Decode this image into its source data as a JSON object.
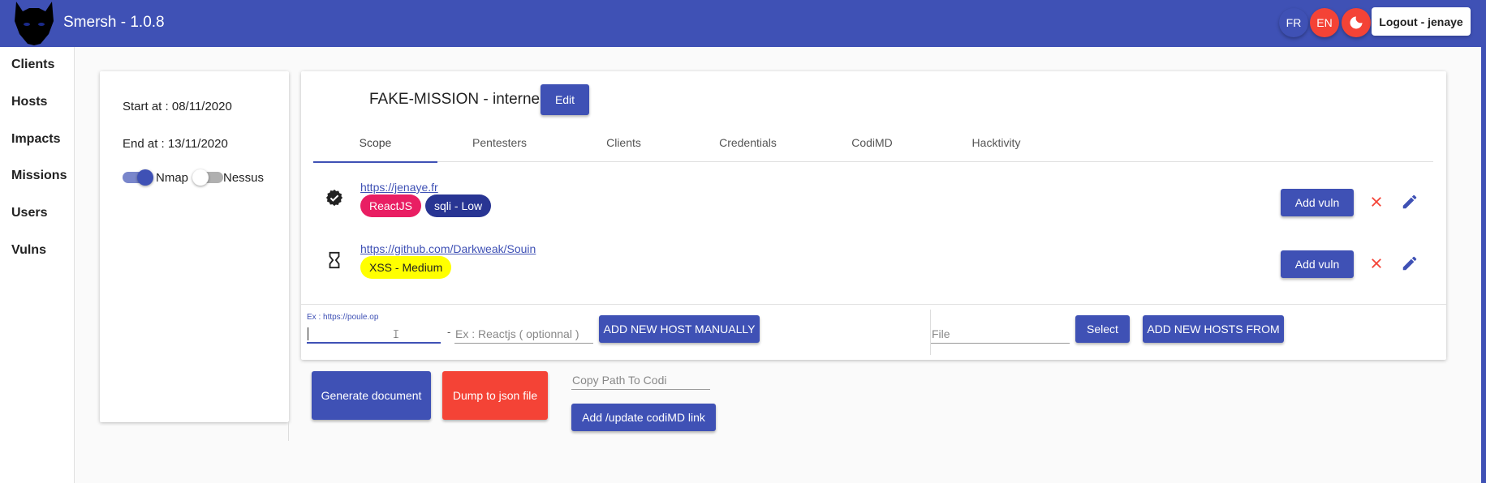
{
  "app": {
    "title": "Smersh - 1.0.8"
  },
  "header": {
    "lang_fr": "FR",
    "lang_en": "EN",
    "logout_label": "Logout - jenaye"
  },
  "sidebar": {
    "items": [
      {
        "label": "Clients"
      },
      {
        "label": "Hosts"
      },
      {
        "label": "Impacts"
      },
      {
        "label": "Missions"
      },
      {
        "label": "Users"
      },
      {
        "label": "Vulns"
      }
    ]
  },
  "mission": {
    "start": "Start at : 08/11/2020",
    "end": "End at : 13/11/2020",
    "nmap_label": "Nmap",
    "nmap_enabled": true,
    "nessus_label": "Nessus",
    "nessus_enabled": false,
    "title": "FAKE-MISSION - interne",
    "edit_label": "Edit"
  },
  "tabs": [
    {
      "label": "Scope",
      "active": true
    },
    {
      "label": "Pentesters"
    },
    {
      "label": "Clients"
    },
    {
      "label": "Credentials"
    },
    {
      "label": "CodiMD"
    },
    {
      "label": "Hacktivity"
    }
  ],
  "hosts": [
    {
      "url": "https://jenaye.fr",
      "status_icon": "verified-icon",
      "tags": [
        {
          "label": "ReactJS",
          "color": "#e91e63"
        },
        {
          "label": "sqli - Low",
          "color": "#283593"
        }
      ],
      "add_vuln_label": "Add vuln"
    },
    {
      "url": "https://github.com/Darkweak/Souin",
      "status_icon": "hourglass-icon",
      "tags": [
        {
          "label": "XSS - Medium",
          "color": "#ffff00"
        }
      ],
      "add_vuln_label": "Add vuln"
    }
  ],
  "add_host": {
    "url_label": "Ex : https://poule.op",
    "url_value": "",
    "dash": "-",
    "tech_placeholder": "Ex : Reactjs ( optionnal )",
    "add_manual_label": "ADD NEW HOST MANUALLY",
    "file_placeholder": "File",
    "select_label": "Select",
    "add_from_label": "ADD NEW HOSTS FROM"
  },
  "actions": {
    "generate_label": "Generate document",
    "dump_label": "Dump to json file",
    "codi_placeholder": "Copy Path To Codi",
    "codi_button_label": "Add /update codiMD link"
  },
  "colors": {
    "primary": "#3f51b5",
    "accent": "#f44336"
  }
}
